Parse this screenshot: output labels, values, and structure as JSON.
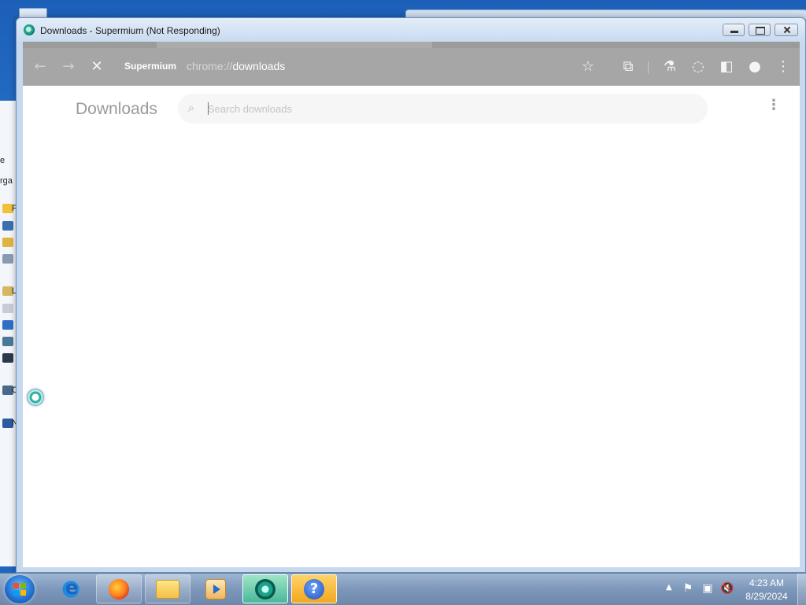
{
  "window": {
    "title": "Downloads - Supermium (Not Responding)"
  },
  "toolbar": {
    "back_icon": "arrow-left-icon",
    "forward_icon": "arrow-right-icon",
    "stop_icon": "close-icon",
    "site_chip": "Supermium",
    "url_scheme": "chrome://",
    "url_host": "downloads",
    "bookmark_icon": "star-icon",
    "extensions_icon": "puzzle-icon",
    "labs_icon": "flask-icon",
    "loading_icon": "spinner-icon",
    "side_panel_icon": "side-panel-icon",
    "profile_icon": "account-icon",
    "menu_icon": "kebab-menu-icon"
  },
  "page": {
    "title": "Downloads",
    "search_placeholder": "Search downloads"
  },
  "background": {
    "explorer_letters": [
      "e",
      "rga",
      "F",
      "L",
      "C",
      "N"
    ]
  },
  "taskbar": {
    "apps": [
      {
        "name": "internet-explorer",
        "icon": "ie-icon"
      },
      {
        "name": "firefox",
        "icon": "firefox-icon"
      },
      {
        "name": "file-explorer",
        "icon": "folder-icon"
      },
      {
        "name": "media-player",
        "icon": "media-icon"
      },
      {
        "name": "supermium",
        "icon": "supermium-icon"
      },
      {
        "name": "help",
        "icon": "help-icon"
      }
    ],
    "help_glyph": "?",
    "tray_arrow": "▲",
    "clock_time": "4:23 AM",
    "clock_date": "8/29/2024"
  },
  "colors": {
    "toolbar_bg": "#a6a6a6",
    "page_title": "#9a9a9a",
    "taskbar": "#7d97ba",
    "active_app": "#49b79a"
  }
}
